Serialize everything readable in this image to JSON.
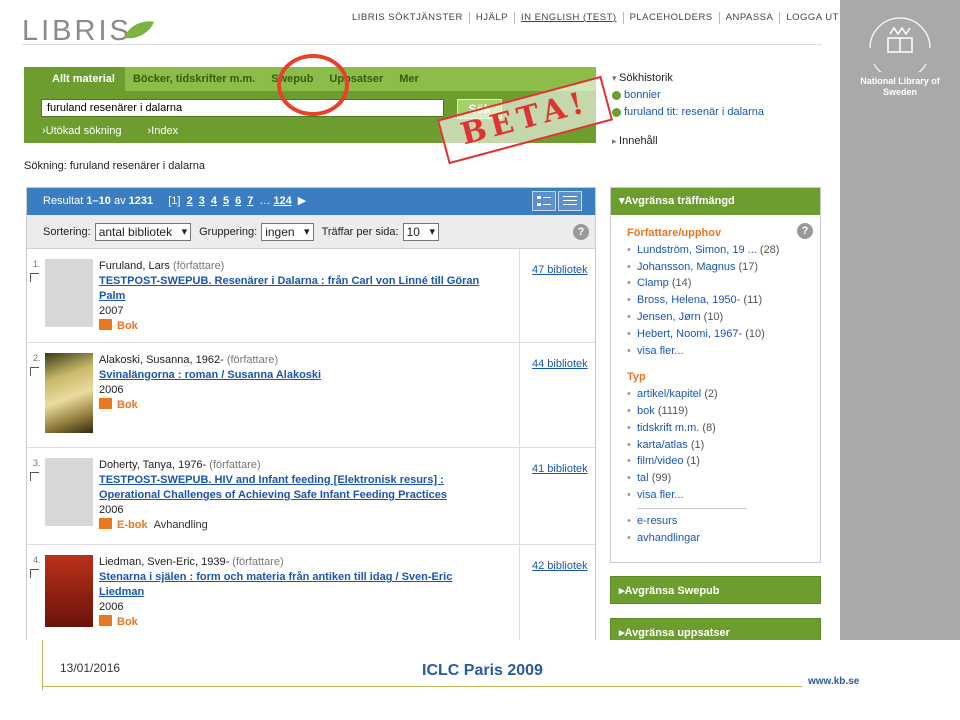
{
  "logo": {
    "text": "LIBRIS"
  },
  "topnav": [
    "LIBRIS SÖKTJÄNSTER",
    "HJÄLP",
    "IN ENGLISH (TEST)",
    "PLACEHOLDERS",
    "ANPASSA",
    "LOGGA UT"
  ],
  "search": {
    "tabs": [
      "Allt material",
      "Böcker, tidskrifter m.m.",
      "Swepub",
      "Uppsatser",
      "Mer"
    ],
    "query": "furuland resenärer i dalarna",
    "button": "Sök",
    "advanced": "Utökad sökning",
    "index": "Index"
  },
  "history": {
    "heading": "Sökhistorik",
    "items": [
      "bonnier",
      "furuland tit: resenär i dalarna"
    ],
    "content_heading": "Innehåll"
  },
  "beta": "BETA!",
  "breadcrumb": "Sökning: furuland resenärer i dalarna",
  "results": {
    "label_prefix": "Resultat",
    "range": "1–10",
    "of": "av",
    "total": "1231",
    "current_page": "[1]",
    "pages": [
      "2",
      "3",
      "4",
      "5",
      "6",
      "7"
    ],
    "ellipsis": "…",
    "last_page": "124",
    "next": "▶",
    "sort_label": "Sortering:",
    "sort_value": "antal bibliotek",
    "group_label": "Gruppering:",
    "group_value": "ingen",
    "perpage_label": "Träffar per sida:",
    "perpage_value": "10",
    "records": [
      {
        "num": "1.",
        "author": "Furuland, Lars",
        "role": "(författare)",
        "title": "TESTPOST-SWEPUB. Resenärer i Dalarna : från Carl von Linné till Göran Palm",
        "year": "2007",
        "type": "Bok",
        "extra": "",
        "libraries": "47 bibliotek"
      },
      {
        "num": "2.",
        "author": "Alakoski, Susanna, 1962-",
        "role": "(författare)",
        "title": "Svinalängorna : roman / Susanna Alakoski",
        "year": "2006",
        "type": "Bok",
        "extra": "",
        "libraries": "44 bibliotek"
      },
      {
        "num": "3.",
        "author": "Doherty, Tanya, 1976-",
        "role": "(författare)",
        "title": "TESTPOST-SWEPUB. HIV and Infant feeding [Elektronisk resurs] : Operational Challenges of Achieving Safe Infant Feeding Practices",
        "year": "2006",
        "type": "E-bok",
        "extra": "Avhandling",
        "libraries": "41 bibliotek"
      },
      {
        "num": "4.",
        "author": "Liedman, Sven-Eric, 1939-",
        "role": "(författare)",
        "title": "Stenarna i själen : form och materia från antiken till idag / Sven-Eric Liedman",
        "year": "2006",
        "type": "Bok",
        "extra": "",
        "libraries": "42 bibliotek"
      }
    ]
  },
  "facets": {
    "heading": "Avgränsa träffmängd",
    "author_heading": "Författare/upphov",
    "authors": [
      {
        "name": "Lundström, Simon, 19 ...",
        "count": "(28)"
      },
      {
        "name": "Johansson, Magnus",
        "count": "(17)"
      },
      {
        "name": "Clamp",
        "count": "(14)"
      },
      {
        "name": "Bross, Helena, 1950-",
        "count": "(11)"
      },
      {
        "name": "Jensen, Jørn",
        "count": "(10)"
      },
      {
        "name": "Hebert, Noomi, 1967-",
        "count": "(10)"
      }
    ],
    "authors_more": "visa fler...",
    "type_heading": "Typ",
    "types": [
      {
        "name": "artikel/kapitel",
        "count": "(2)"
      },
      {
        "name": "bok",
        "count": "(1119)"
      },
      {
        "name": "tidskrift m.m.",
        "count": "(8)"
      },
      {
        "name": "karta/atlas",
        "count": "(1)"
      },
      {
        "name": "film/video",
        "count": "(1)"
      },
      {
        "name": "tal",
        "count": "(99)"
      }
    ],
    "types_more": "visa fler...",
    "extra": [
      "e-resurs",
      "avhandlingar"
    ],
    "swepub": "Avgränsa Swepub",
    "uppsatser": "Avgränsa uppsatser"
  },
  "kb": {
    "name": "National Library of Sweden",
    "seal": "KUNGL BIBLIOTEKET"
  },
  "footer": {
    "date": "13/01/2016",
    "conference": "ICLC Paris 2009",
    "site": "www.kb.se"
  },
  "colors": {
    "green": "#6d9d2f",
    "blue": "#3b7dc1",
    "orange": "#e87722",
    "red": "#e8402a"
  }
}
